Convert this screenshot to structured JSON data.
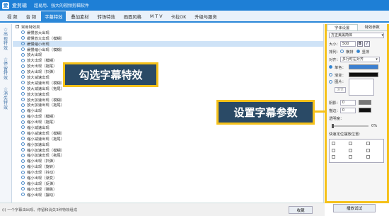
{
  "titlebar": {
    "app_name": "爱剪辑",
    "slogan": "超易用、强大的视频剪辑软件",
    "logo": "爱"
  },
  "tabs": [
    {
      "label": "视 频"
    },
    {
      "label": "音 频"
    },
    {
      "label": "字幕特效",
      "active": true
    },
    {
      "label": "叠加素材"
    },
    {
      "label": "转场特效"
    },
    {
      "label": "画面风格"
    },
    {
      "label": "M T V"
    },
    {
      "label": "卡拉OK"
    },
    {
      "label": "升级与服务"
    }
  ],
  "sidebar": [
    {
      "icon": "star-icon",
      "glyph": "☆",
      "label": "出现特效"
    },
    {
      "icon": "star-icon",
      "glyph": "☆",
      "label": "停留特效"
    },
    {
      "icon": "star-icon",
      "glyph": "☆",
      "label": "消失特效"
    }
  ],
  "effects": [
    {
      "label": "常用特效类",
      "type": "group"
    },
    {
      "label": "缓慢放大出现"
    },
    {
      "label": "缓慢放大出现（模糊）"
    },
    {
      "label": "缓慢缩小出现",
      "selected": true
    },
    {
      "label": "缓慢缩小出现（模糊）"
    },
    {
      "label": "放大出现"
    },
    {
      "label": "放大出现（模糊）"
    },
    {
      "label": "放大出现（拖尾）"
    },
    {
      "label": "放大出现（扫弹）"
    },
    {
      "label": "放大减速出现"
    },
    {
      "label": "放大减速出现（模糊）"
    },
    {
      "label": "放大减速出现（拖尾）"
    },
    {
      "label": "放大加速出现"
    },
    {
      "label": "放大加速出现（模糊）"
    },
    {
      "label": "放大加速出现（拖尾）"
    },
    {
      "label": "缩小出现"
    },
    {
      "label": "缩小出现（模糊）"
    },
    {
      "label": "缩小出现（拖尾）"
    },
    {
      "label": "缩小减速出现"
    },
    {
      "label": "缩小减速出现（模糊）"
    },
    {
      "label": "缩小减速出现（拖尾）"
    },
    {
      "label": "缩小加速出现"
    },
    {
      "label": "缩小加速出现（模糊）"
    },
    {
      "label": "缩小加速出现（拖尾）"
    },
    {
      "label": "缩小出现（扫弹）"
    },
    {
      "label": "缩小出现（旋转）"
    },
    {
      "label": "缩小出现（抖动）"
    },
    {
      "label": "缩小出现（渐变）"
    },
    {
      "label": "缩小出现（反弹）"
    },
    {
      "label": "缩小出现（弹跳）"
    },
    {
      "label": "缩小出现（摆动）"
    }
  ],
  "callouts": {
    "select_effect": "勾选字幕特效",
    "set_params": "设置字幕参数"
  },
  "right_panel": {
    "tabs": [
      {
        "label": "字体设置",
        "active": true
      },
      {
        "label": "特效参数"
      }
    ],
    "font_name": "方正美黑简体",
    "size_label": "大小：",
    "size_value": "500",
    "bold": "B",
    "italic": "I",
    "direction_label": "排列：",
    "horizontal": "横排",
    "vertical": "竖排",
    "align_label": "对齐：",
    "align_value": "多行时左对齐",
    "single_color_label": "单色：",
    "gradient_label": "渐变：",
    "image_label": "图片：",
    "browse_label": "浏览",
    "shadow_label": "阴影：",
    "shadow_value": "0",
    "stroke_label": "描边：",
    "stroke_value": "0",
    "opacity_label": "透明度：",
    "opacity_value": "0%",
    "position_label": "快速定位摆放位置：",
    "dropdown_arrow": "▾",
    "play_button": "播放试试"
  },
  "bottombar": {
    "hint": "(i) 一个字幕由出现、停留和消失3种特效组成",
    "fav_button": "收藏"
  },
  "colors": {
    "accent": "#1e7fd6",
    "callout_bg": "#2a4a66",
    "callout_border": "#f5c11a",
    "selected_row": "#cfe3f7"
  }
}
